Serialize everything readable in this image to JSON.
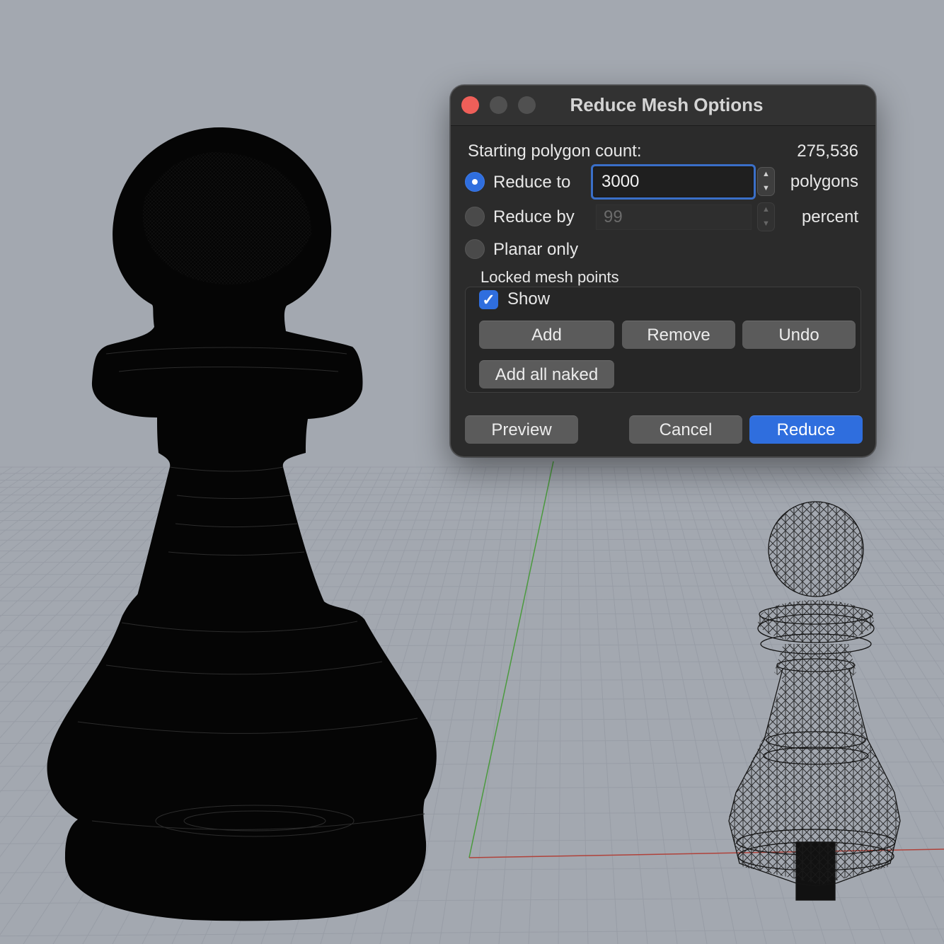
{
  "dialog": {
    "title": "Reduce Mesh Options",
    "starting_count_label": "Starting polygon count:",
    "starting_count_value": "275,536",
    "reduce_to_label": "Reduce to",
    "reduce_to_value": "3000",
    "reduce_to_unit": "polygons",
    "reduce_by_label": "Reduce by",
    "reduce_by_value": "99",
    "reduce_by_unit": "percent",
    "planar_only_label": "Planar only",
    "locked_group_label": "Locked mesh points",
    "show_label": "Show",
    "show_checked": true,
    "add_label": "Add",
    "remove_label": "Remove",
    "undo_label": "Undo",
    "add_all_naked_label": "Add all naked",
    "preview_label": "Preview",
    "cancel_label": "Cancel",
    "reduce_label": "Reduce",
    "selected_option": "Reduce to",
    "accent_color": "#2f6ede",
    "close_color": "#ee5f59"
  },
  "viewport": {
    "background_color": "#a3a8b0",
    "grid_color": "#9ca1a9",
    "x_axis_color": "#b0423a",
    "y_axis_color": "#4b9a3e",
    "objects": [
      "shaded-pawn-high-poly",
      "wireframe-pawn-reduced"
    ]
  }
}
